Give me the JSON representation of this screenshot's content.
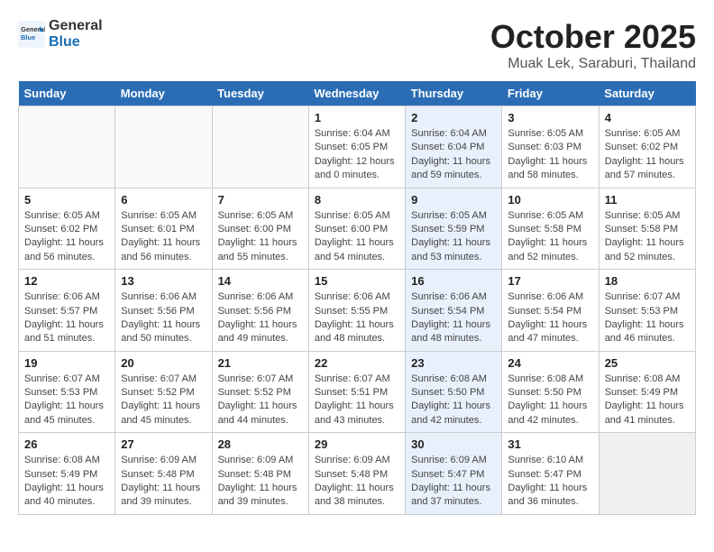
{
  "header": {
    "logo_general": "General",
    "logo_blue": "Blue",
    "month": "October 2025",
    "location": "Muak Lek, Saraburi, Thailand"
  },
  "weekdays": [
    "Sunday",
    "Monday",
    "Tuesday",
    "Wednesday",
    "Thursday",
    "Friday",
    "Saturday"
  ],
  "weeks": [
    [
      {
        "day": "",
        "sunrise": "",
        "sunset": "",
        "daylight": ""
      },
      {
        "day": "",
        "sunrise": "",
        "sunset": "",
        "daylight": ""
      },
      {
        "day": "",
        "sunrise": "",
        "sunset": "",
        "daylight": ""
      },
      {
        "day": "1",
        "sunrise": "Sunrise: 6:04 AM",
        "sunset": "Sunset: 6:05 PM",
        "daylight": "Daylight: 12 hours and 0 minutes."
      },
      {
        "day": "2",
        "sunrise": "Sunrise: 6:04 AM",
        "sunset": "Sunset: 6:04 PM",
        "daylight": "Daylight: 11 hours and 59 minutes."
      },
      {
        "day": "3",
        "sunrise": "Sunrise: 6:05 AM",
        "sunset": "Sunset: 6:03 PM",
        "daylight": "Daylight: 11 hours and 58 minutes."
      },
      {
        "day": "4",
        "sunrise": "Sunrise: 6:05 AM",
        "sunset": "Sunset: 6:02 PM",
        "daylight": "Daylight: 11 hours and 57 minutes."
      }
    ],
    [
      {
        "day": "5",
        "sunrise": "Sunrise: 6:05 AM",
        "sunset": "Sunset: 6:02 PM",
        "daylight": "Daylight: 11 hours and 56 minutes."
      },
      {
        "day": "6",
        "sunrise": "Sunrise: 6:05 AM",
        "sunset": "Sunset: 6:01 PM",
        "daylight": "Daylight: 11 hours and 56 minutes."
      },
      {
        "day": "7",
        "sunrise": "Sunrise: 6:05 AM",
        "sunset": "Sunset: 6:00 PM",
        "daylight": "Daylight: 11 hours and 55 minutes."
      },
      {
        "day": "8",
        "sunrise": "Sunrise: 6:05 AM",
        "sunset": "Sunset: 6:00 PM",
        "daylight": "Daylight: 11 hours and 54 minutes."
      },
      {
        "day": "9",
        "sunrise": "Sunrise: 6:05 AM",
        "sunset": "Sunset: 5:59 PM",
        "daylight": "Daylight: 11 hours and 53 minutes."
      },
      {
        "day": "10",
        "sunrise": "Sunrise: 6:05 AM",
        "sunset": "Sunset: 5:58 PM",
        "daylight": "Daylight: 11 hours and 52 minutes."
      },
      {
        "day": "11",
        "sunrise": "Sunrise: 6:05 AM",
        "sunset": "Sunset: 5:58 PM",
        "daylight": "Daylight: 11 hours and 52 minutes."
      }
    ],
    [
      {
        "day": "12",
        "sunrise": "Sunrise: 6:06 AM",
        "sunset": "Sunset: 5:57 PM",
        "daylight": "Daylight: 11 hours and 51 minutes."
      },
      {
        "day": "13",
        "sunrise": "Sunrise: 6:06 AM",
        "sunset": "Sunset: 5:56 PM",
        "daylight": "Daylight: 11 hours and 50 minutes."
      },
      {
        "day": "14",
        "sunrise": "Sunrise: 6:06 AM",
        "sunset": "Sunset: 5:56 PM",
        "daylight": "Daylight: 11 hours and 49 minutes."
      },
      {
        "day": "15",
        "sunrise": "Sunrise: 6:06 AM",
        "sunset": "Sunset: 5:55 PM",
        "daylight": "Daylight: 11 hours and 48 minutes."
      },
      {
        "day": "16",
        "sunrise": "Sunrise: 6:06 AM",
        "sunset": "Sunset: 5:54 PM",
        "daylight": "Daylight: 11 hours and 48 minutes."
      },
      {
        "day": "17",
        "sunrise": "Sunrise: 6:06 AM",
        "sunset": "Sunset: 5:54 PM",
        "daylight": "Daylight: 11 hours and 47 minutes."
      },
      {
        "day": "18",
        "sunrise": "Sunrise: 6:07 AM",
        "sunset": "Sunset: 5:53 PM",
        "daylight": "Daylight: 11 hours and 46 minutes."
      }
    ],
    [
      {
        "day": "19",
        "sunrise": "Sunrise: 6:07 AM",
        "sunset": "Sunset: 5:53 PM",
        "daylight": "Daylight: 11 hours and 45 minutes."
      },
      {
        "day": "20",
        "sunrise": "Sunrise: 6:07 AM",
        "sunset": "Sunset: 5:52 PM",
        "daylight": "Daylight: 11 hours and 45 minutes."
      },
      {
        "day": "21",
        "sunrise": "Sunrise: 6:07 AM",
        "sunset": "Sunset: 5:52 PM",
        "daylight": "Daylight: 11 hours and 44 minutes."
      },
      {
        "day": "22",
        "sunrise": "Sunrise: 6:07 AM",
        "sunset": "Sunset: 5:51 PM",
        "daylight": "Daylight: 11 hours and 43 minutes."
      },
      {
        "day": "23",
        "sunrise": "Sunrise: 6:08 AM",
        "sunset": "Sunset: 5:50 PM",
        "daylight": "Daylight: 11 hours and 42 minutes."
      },
      {
        "day": "24",
        "sunrise": "Sunrise: 6:08 AM",
        "sunset": "Sunset: 5:50 PM",
        "daylight": "Daylight: 11 hours and 42 minutes."
      },
      {
        "day": "25",
        "sunrise": "Sunrise: 6:08 AM",
        "sunset": "Sunset: 5:49 PM",
        "daylight": "Daylight: 11 hours and 41 minutes."
      }
    ],
    [
      {
        "day": "26",
        "sunrise": "Sunrise: 6:08 AM",
        "sunset": "Sunset: 5:49 PM",
        "daylight": "Daylight: 11 hours and 40 minutes."
      },
      {
        "day": "27",
        "sunrise": "Sunrise: 6:09 AM",
        "sunset": "Sunset: 5:48 PM",
        "daylight": "Daylight: 11 hours and 39 minutes."
      },
      {
        "day": "28",
        "sunrise": "Sunrise: 6:09 AM",
        "sunset": "Sunset: 5:48 PM",
        "daylight": "Daylight: 11 hours and 39 minutes."
      },
      {
        "day": "29",
        "sunrise": "Sunrise: 6:09 AM",
        "sunset": "Sunset: 5:48 PM",
        "daylight": "Daylight: 11 hours and 38 minutes."
      },
      {
        "day": "30",
        "sunrise": "Sunrise: 6:09 AM",
        "sunset": "Sunset: 5:47 PM",
        "daylight": "Daylight: 11 hours and 37 minutes."
      },
      {
        "day": "31",
        "sunrise": "Sunrise: 6:10 AM",
        "sunset": "Sunset: 5:47 PM",
        "daylight": "Daylight: 11 hours and 36 minutes."
      },
      {
        "day": "",
        "sunrise": "",
        "sunset": "",
        "daylight": ""
      }
    ]
  ]
}
